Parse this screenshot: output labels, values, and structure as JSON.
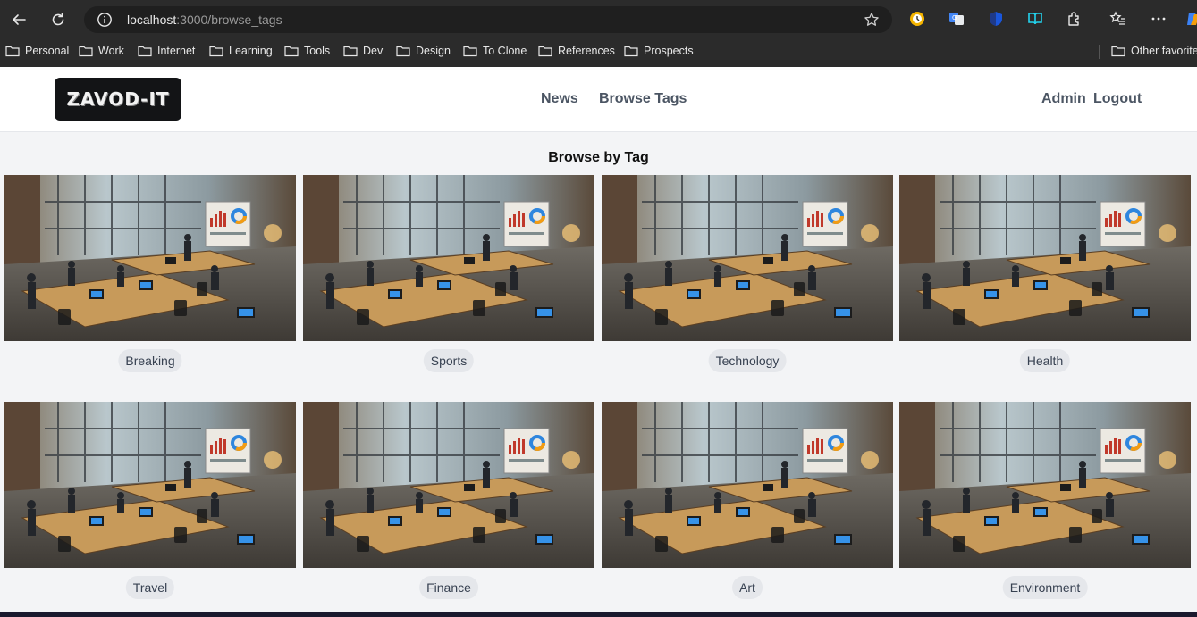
{
  "browser": {
    "url_host": "localhost",
    "url_rest": ":3000/browse_tags",
    "bookmarks": [
      "Personal",
      "Work",
      "Internet",
      "Learning",
      "Tools",
      "Dev",
      "Design",
      "To Clone",
      "References",
      "Prospects"
    ],
    "other_bookmarks": "Other favorite"
  },
  "site": {
    "logo_text": "ZAVOD-IT",
    "nav": {
      "news": "News",
      "browse_tags": "Browse Tags",
      "admin": "Admin",
      "logout": "Logout"
    }
  },
  "main": {
    "title": "Browse by Tag",
    "tags": [
      "Breaking",
      "Sports",
      "Technology",
      "Health",
      "Travel",
      "Finance",
      "Art",
      "Environment"
    ]
  },
  "colors": {
    "page_bg": "#f3f4f6",
    "header_bg": "#ffffff",
    "nav_text": "#4b5563",
    "tag_bg": "#e5e7eb",
    "tag_text": "#374151",
    "chrome_bg": "#2b2b2b"
  },
  "icons": {
    "back": "arrow-left-icon",
    "reload": "reload-icon",
    "site_info": "info-icon",
    "favorite": "star-icon",
    "folder": "folder-icon"
  }
}
